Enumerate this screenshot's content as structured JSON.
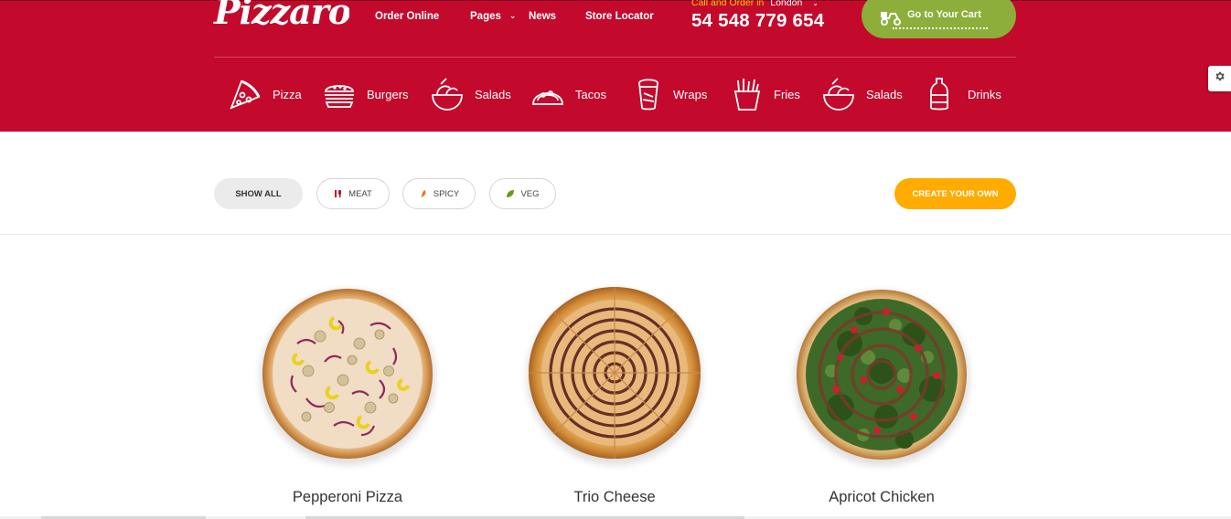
{
  "brand": {
    "logo_text": "Pizzaro"
  },
  "nav": [
    {
      "label": "Order Online",
      "has_caret": false
    },
    {
      "label": "Pages",
      "has_caret": true
    },
    {
      "label": "News",
      "has_caret": false
    },
    {
      "label": "Store Locator",
      "has_caret": false
    }
  ],
  "contact": {
    "call_label": "Call and Order in",
    "city": "London",
    "phone": "54 548 779 654"
  },
  "cart": {
    "label": "Go to Your Cart",
    "icon": "scooter-icon"
  },
  "categories": [
    {
      "label": "Pizza",
      "icon": "pizza-slice-icon"
    },
    {
      "label": "Burgers",
      "icon": "burger-icon"
    },
    {
      "label": "Salads",
      "icon": "salad-bowl-icon"
    },
    {
      "label": "Tacos",
      "icon": "taco-icon"
    },
    {
      "label": "Wraps",
      "icon": "wrap-icon"
    },
    {
      "label": "Fries",
      "icon": "fries-icon"
    },
    {
      "label": "Salads",
      "icon": "salad-bowl-icon"
    },
    {
      "label": "Drinks",
      "icon": "drink-bottle-icon"
    }
  ],
  "filters": [
    {
      "label": "SHOW ALL",
      "active": true,
      "icon": ""
    },
    {
      "label": "MEAT",
      "active": false,
      "icon": "meat-icon",
      "icon_color": "#c30a2c"
    },
    {
      "label": "SPICY",
      "active": false,
      "icon": "chili-icon",
      "icon_color": "#f26b1d"
    },
    {
      "label": "VEG",
      "active": false,
      "icon": "leaf-icon",
      "icon_color": "#6a9a23"
    }
  ],
  "create_button": {
    "label": "CREATE YOUR OWN"
  },
  "settings": {
    "icon": "gear-icon"
  },
  "products": [
    {
      "name": "Pepperoni Pizza",
      "image": "pepperoni-pizza-image"
    },
    {
      "name": "Trio Cheese",
      "image": "trio-cheese-pizza-image"
    },
    {
      "name": "Apricot Chicken",
      "image": "apricot-chicken-pizza-image"
    }
  ],
  "colors": {
    "header_red": "#c30a2c",
    "cart_green": "#8dae3b",
    "create_orange": "#ffab00",
    "call_yellow": "#ffc400"
  }
}
